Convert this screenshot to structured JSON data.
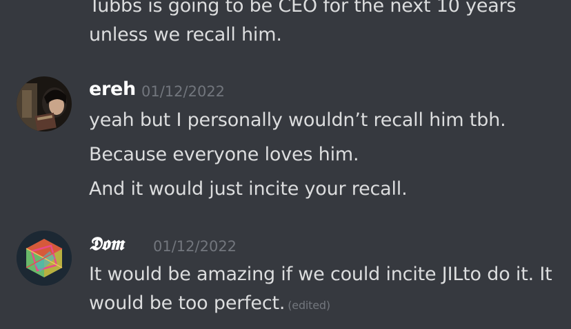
{
  "messages_prev": {
    "line1": "Tubbs is going to be CEO for the next 10 years",
    "line2": "unless we recall him."
  },
  "msg_ereh": {
    "author": "ereh",
    "timestamp": "01/12/2022",
    "avatar_icon": "user-avatar-photo-icon",
    "lines": [
      "yeah but I personally wouldn’t recall him tbh.",
      "Because everyone loves him.",
      "And it would just incite your recall."
    ]
  },
  "msg_dom": {
    "author": "𝕯𝖔𝖒",
    "timestamp": "01/12/2022",
    "avatar_icon": "polyhedron-avatar-icon",
    "line1": "It would be amazing if we could incite JILto do it. It",
    "line2": "would be too perfect.",
    "edited": "(edited)"
  },
  "colors": {
    "background": "#36393f",
    "text": "#dcddde",
    "author": "#ffffff",
    "muted": "#72767d"
  }
}
